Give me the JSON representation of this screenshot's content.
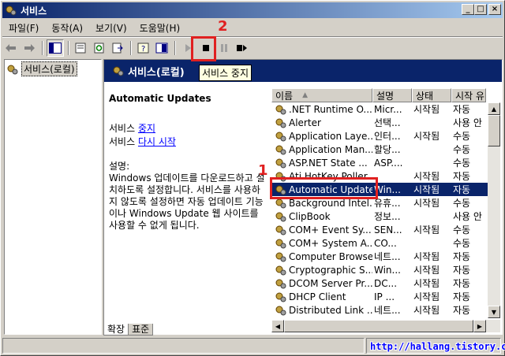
{
  "window": {
    "title": "서비스"
  },
  "menu": {
    "items": [
      "파일(F)",
      "동작(A)",
      "보기(V)",
      "도움말(H)"
    ]
  },
  "tree": {
    "root_label": "서비스(로컬)"
  },
  "pane": {
    "header": "서비스(로컬)",
    "tooltip": "서비스 중지",
    "service_title": "Automatic Updates",
    "action_prefix": "서비스",
    "stop_link": "중지",
    "restart_link": "다시 시작",
    "desc_label": "설명:",
    "desc_text": "Windows 업데이트를 다운로드하고 설치하도록 설정합니다. 서비스를 사용하지 않도록 설정하면 자동 업데이트 기능이나 Windows Update 웹 사이트를 사용할 수 없게 됩니다."
  },
  "list": {
    "columns": [
      "이름",
      "설명",
      "상태",
      "시작 유"
    ],
    "rows": [
      [
        ".NET Runtime O...",
        "Micr...",
        "시작됨",
        "자동"
      ],
      [
        "Alerter",
        "선택...",
        "",
        "사용 안"
      ],
      [
        "Application Laye...",
        "인터...",
        "시작됨",
        "수동"
      ],
      [
        "Application Man...",
        "할당...",
        "",
        "수동"
      ],
      [
        "ASP.NET State ...",
        "ASP....",
        "",
        "수동"
      ],
      [
        "Ati HotKey Poller",
        "",
        "시작됨",
        "자동"
      ],
      [
        "Automatic Updates",
        "Win...",
        "시작됨",
        "자동"
      ],
      [
        "Background Intel...",
        "유휴...",
        "시작됨",
        "수동"
      ],
      [
        "ClipBook",
        "정보...",
        "",
        "사용 안"
      ],
      [
        "COM+ Event Sy...",
        "SEN...",
        "시작됨",
        "수동"
      ],
      [
        "COM+ System A...",
        "CO...",
        "",
        "수동"
      ],
      [
        "Computer Browser",
        "네트...",
        "시작됨",
        "자동"
      ],
      [
        "Cryptographic S...",
        "Win...",
        "시작됨",
        "자동"
      ],
      [
        "DCOM Server Pr...",
        "DC...",
        "시작됨",
        "자동"
      ],
      [
        "DHCP Client",
        "IP ...",
        "시작됨",
        "자동"
      ],
      [
        "Distributed Link ...",
        "네트...",
        "시작됨",
        "자동"
      ]
    ],
    "selected_index": 6
  },
  "tabs": [
    "확장",
    "표준"
  ],
  "status": {
    "watermark": "http://hallang.tistory.com"
  },
  "annotations": {
    "one": "1",
    "two": "2"
  },
  "colors": {
    "titlebar": "#0a246a",
    "selection": "#0a246a",
    "annotation": "#e02020"
  }
}
